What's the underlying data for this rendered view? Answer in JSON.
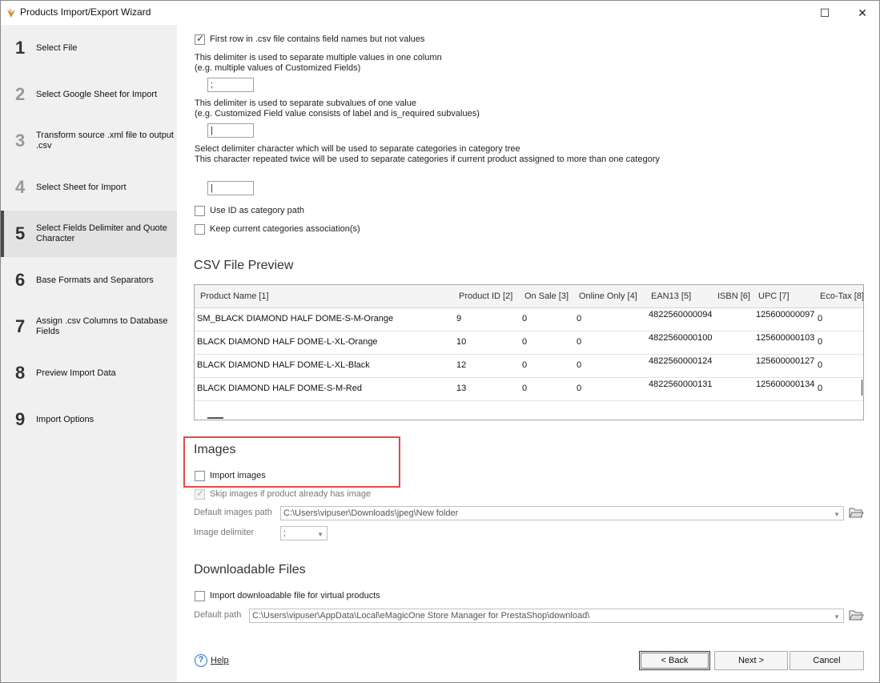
{
  "window": {
    "title": "Products Import/Export Wizard",
    "maximize_glyph": "☐",
    "close_glyph": "✕"
  },
  "steps": [
    {
      "num": "1",
      "label": "Select File"
    },
    {
      "num": "2",
      "label": "Select Google Sheet for Import"
    },
    {
      "num": "3",
      "label": "Transform source .xml file to output .csv"
    },
    {
      "num": "4",
      "label": "Select Sheet for Import"
    },
    {
      "num": "5",
      "label": "Select Fields Delimiter and Quote Character"
    },
    {
      "num": "6",
      "label": "Base Formats and Separators"
    },
    {
      "num": "7",
      "label": "Assign .csv Columns to Database Fields"
    },
    {
      "num": "8",
      "label": "Preview Import Data"
    },
    {
      "num": "9",
      "label": "Import Options"
    }
  ],
  "active_step": 5,
  "options": {
    "first_row_label": "First row in .csv file contains field names but not values",
    "first_row_checked": true,
    "multi_delim_desc1": "This delimiter is used to separate multiple values in one column",
    "multi_delim_desc2": "(e.g. multiple values of Customized Fields)",
    "multi_delim_value": ";",
    "sub_delim_desc1": "This delimiter is used to separate subvalues of one value",
    "sub_delim_desc2": "(e.g. Customized Field value consists of label and is_required subvalues)",
    "sub_delim_value": "|",
    "cat_delim_desc1": "Select delimiter character which will be used to separate categories in category tree",
    "cat_delim_desc2": "This character repeated twice will be used to separate categories if current product assigned to more than one category",
    "cat_delim_value": "|",
    "use_id_label": "Use ID as category path",
    "keep_cat_label": "Keep current categories association(s)"
  },
  "preview": {
    "title": "CSV File Preview",
    "headers": [
      "Product Name [1]",
      "Product ID [2]",
      "On Sale [3]",
      "Online Only [4]",
      "EAN13 [5]",
      "ISBN [6]",
      "UPC [7]",
      "Eco-Tax [8]"
    ],
    "rows": [
      [
        "SM_BLACK DIAMOND HALF DOME-S-M-Orange",
        "9",
        "0",
        "0",
        "4822560000094",
        "",
        "125600000097",
        "0"
      ],
      [
        "BLACK DIAMOND HALF DOME-L-XL-Orange",
        "10",
        "0",
        "0",
        "4822560000100",
        "",
        "125600000103",
        "0"
      ],
      [
        "BLACK DIAMOND HALF DOME-L-XL-Black",
        "12",
        "0",
        "0",
        "4822560000124",
        "",
        "125600000127",
        "0"
      ],
      [
        "BLACK DIAMOND HALF DOME-S-M-Red",
        "13",
        "0",
        "0",
        "4822560000131",
        "",
        "125600000134",
        "0"
      ]
    ]
  },
  "images": {
    "title": "Images",
    "import_label": "Import images",
    "skip_label": "Skip images if product already has image",
    "path_label": "Default images path",
    "path_value": "C:\\Users\\vipuser\\Downloads\\jpeg\\New folder",
    "delim_label": "Image delimiter",
    "delim_value": ";"
  },
  "downloadable": {
    "title": "Downloadable Files",
    "import_label": "Import downloadable file for virtual products",
    "path_label": "Default path",
    "path_value": "C:\\Users\\vipuser\\AppData\\Local\\eMagicOne Store Manager for PrestaShop\\download\\"
  },
  "footer": {
    "help": "Help",
    "back": "< Back",
    "next": "Next >",
    "cancel": "Cancel"
  },
  "colors": {
    "highlight": "#e04a4a",
    "help_icon": "#2a70c8"
  }
}
